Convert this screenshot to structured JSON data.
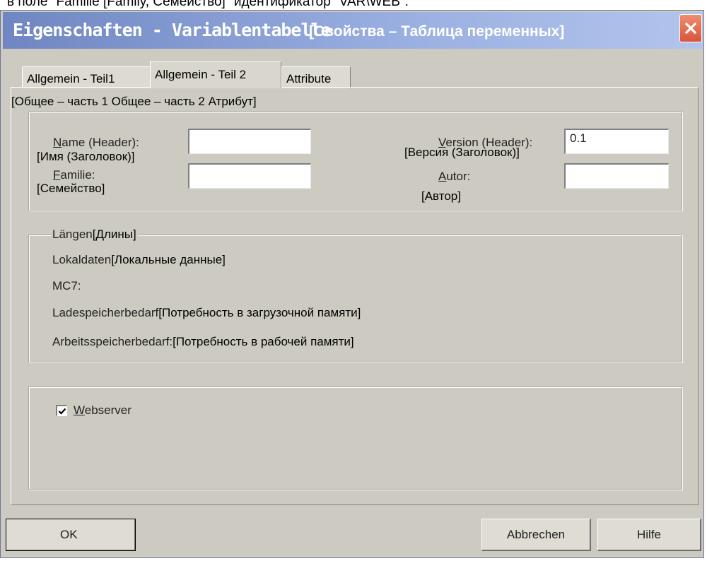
{
  "caption_top": "в поле \"Familie [Family, Семейство]\" идентификатор \"VAR\\WEB\".",
  "window": {
    "title": "Eigenschaften - Variablentabelle",
    "title_translation": "[Свойства – Таблица переменных]",
    "close_icon": "close-x-icon"
  },
  "tabs": [
    {
      "label": "Allgemein - Teil1",
      "selected": false
    },
    {
      "label": "Allgemein - Teil 2",
      "selected": true
    },
    {
      "label": "Attribute",
      "selected": false
    }
  ],
  "tabs_translation": "[Общее – часть 1   Общее – часть 2  Атрибут]",
  "header": {
    "name": {
      "label": "Name (Header):",
      "translation": "[Имя (Заголовок)]",
      "value": ""
    },
    "familie": {
      "label": "Familie:",
      "translation": "[Семейство]",
      "value": ""
    },
    "version": {
      "label": "Version (Header):",
      "translation": "[Версия (Заголовок)]",
      "value": "0.1"
    },
    "autor": {
      "label": "Autor:",
      "translation": "[Автор]",
      "value": ""
    }
  },
  "lengths": {
    "title": "Längen",
    "title_translation": "[Длины]",
    "rows": [
      {
        "label": "Lokaldaten",
        "translation": "[Локальные данные]"
      },
      {
        "label": "MC7:",
        "translation": ""
      },
      {
        "label": "Ladespeicherbedarf",
        "translation": "[Потребность в загрузочной памяти]"
      },
      {
        "label": "Arbeitsspeicherbedarf:",
        "translation": "[Потребность в рабочей памяти]"
      }
    ]
  },
  "webserver": {
    "label": "Webserver",
    "checked": true
  },
  "buttons": {
    "ok": "OK",
    "cancel": "Abbrechen",
    "help": "Hilfe"
  }
}
